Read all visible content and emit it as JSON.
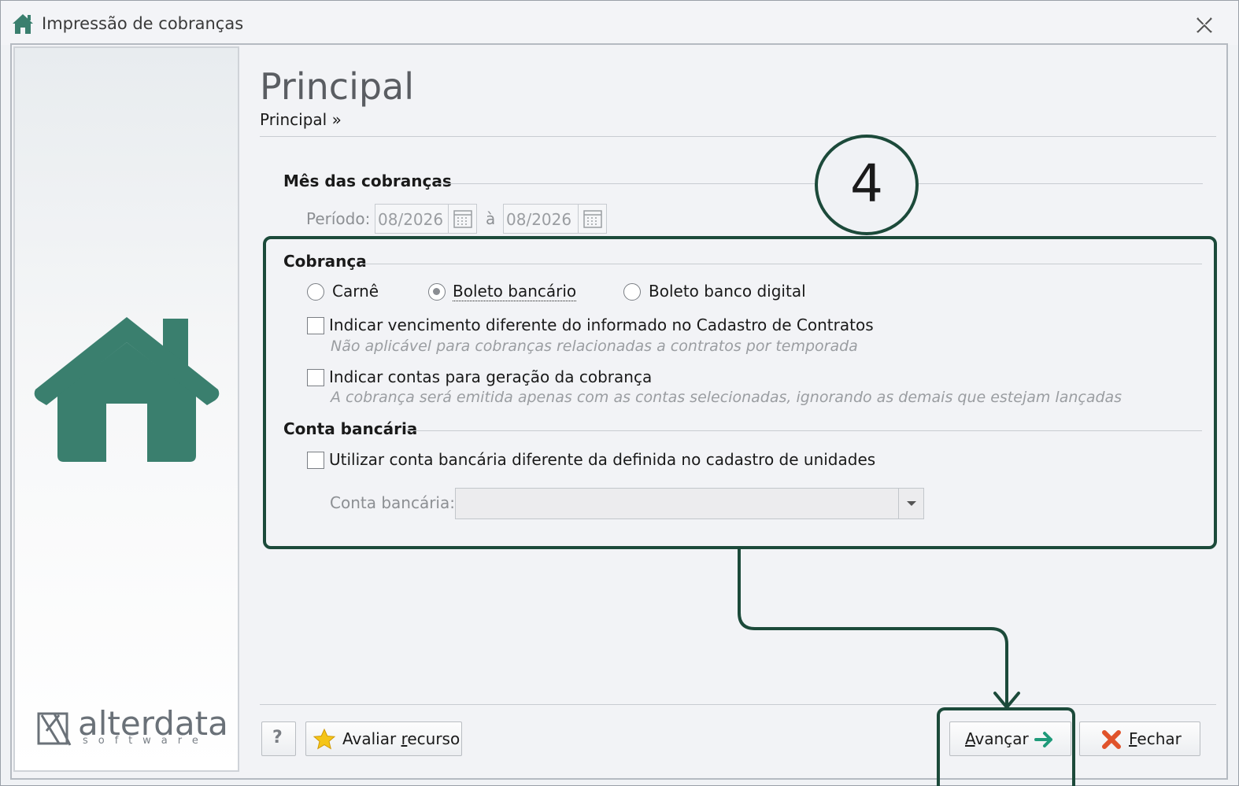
{
  "window": {
    "title": "Impressão de cobranças"
  },
  "sidebar": {
    "logo_word": "alterdata",
    "logo_sub": "software"
  },
  "header": {
    "title": "Principal",
    "breadcrumb": "Principal »"
  },
  "mes": {
    "heading": "Mês das cobranças",
    "periodo_label": "Período:",
    "start": "08/2026",
    "sep": "à",
    "end": "08/2026"
  },
  "cobranca": {
    "heading": "Cobrança",
    "options": [
      "Carnê",
      "Boleto bancário",
      "Boleto banco digital"
    ],
    "selected": "Boleto bancário",
    "check1_label": "Indicar vencimento diferente do informado no Cadastro de Contratos",
    "check1_hint": "Não aplicável para cobranças relacionadas a contratos por temporada",
    "check2_label": "Indicar contas para geração da cobrança",
    "check2_hint": "A cobrança será emitida apenas com as contas selecionadas, ignorando as demais que estejam lançadas"
  },
  "conta": {
    "heading": "Conta bancária",
    "check_label": "Utilizar conta bancária diferente da definida no cadastro de unidades",
    "select_label": "Conta bancária:",
    "select_value": ""
  },
  "footer": {
    "help_label": "?",
    "rate_label": "Avaliar recurso",
    "next_label": "Avançar",
    "close_label": "Fechar"
  },
  "annotation": {
    "step": "4"
  },
  "colors": {
    "brand_green": "#3a7f6e",
    "annotation": "#1c4a3a",
    "close_red": "#e0532b"
  },
  "icons": {
    "title": "home-icon",
    "calendar": "calendar-icon",
    "star": "star-icon",
    "arrow": "arrow-right-icon",
    "close": "close-x-icon"
  }
}
